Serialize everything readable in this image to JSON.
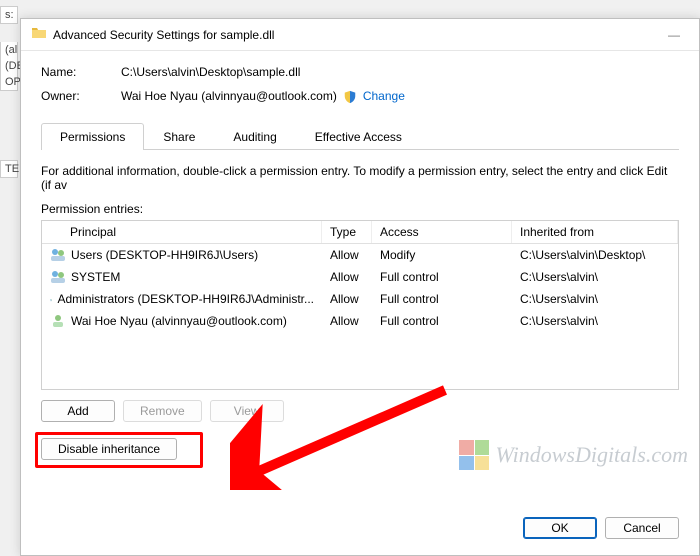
{
  "dialog": {
    "title": "Advanced Security Settings for sample.dll",
    "name_label": "Name:",
    "name_value": "C:\\Users\\alvin\\Desktop\\sample.dll",
    "owner_label": "Owner:",
    "owner_value": "Wai Hoe Nyau (alvinnyau@outlook.com)",
    "change_link": "Change"
  },
  "tabs": {
    "permissions": "Permissions",
    "share": "Share",
    "auditing": "Auditing",
    "effective": "Effective Access"
  },
  "info_text": "For additional information, double-click a permission entry. To modify a permission entry, select the entry and click Edit (if av",
  "entries_label": "Permission entries:",
  "columns": {
    "principal": "Principal",
    "type": "Type",
    "access": "Access",
    "inherited": "Inherited from"
  },
  "rows": [
    {
      "icon": "group",
      "principal": "Users (DESKTOP-HH9IR6J\\Users)",
      "type": "Allow",
      "access": "Modify",
      "inherited": "C:\\Users\\alvin\\Desktop\\"
    },
    {
      "icon": "group",
      "principal": "SYSTEM",
      "type": "Allow",
      "access": "Full control",
      "inherited": "C:\\Users\\alvin\\"
    },
    {
      "icon": "group",
      "principal": "Administrators (DESKTOP-HH9IR6J\\Administr...",
      "type": "Allow",
      "access": "Full control",
      "inherited": "C:\\Users\\alvin\\"
    },
    {
      "icon": "user",
      "principal": "Wai Hoe Nyau (alvinnyau@outlook.com)",
      "type": "Allow",
      "access": "Full control",
      "inherited": "C:\\Users\\alvin\\"
    }
  ],
  "buttons": {
    "add": "Add",
    "remove": "Remove",
    "view": "View",
    "disable": "Disable inheritance",
    "ok": "OK",
    "cancel": "Cancel"
  },
  "watermark": "WindowsDigitals.com",
  "bg": {
    "partial1": "s:",
    "partial2": "(al",
    "partial3": "(DE",
    "partial4": "OP",
    "partial5": "TE"
  }
}
